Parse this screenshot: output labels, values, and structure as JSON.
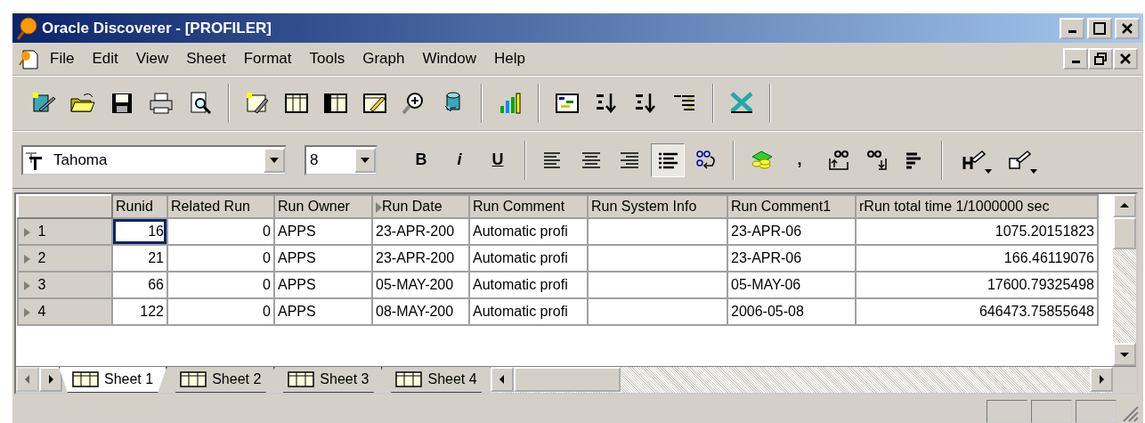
{
  "window": {
    "title": "Oracle Discoverer - [PROFILER]"
  },
  "menu": [
    "File",
    "Edit",
    "View",
    "Sheet",
    "Format",
    "Tools",
    "Graph",
    "Window",
    "Help"
  ],
  "format_bar": {
    "font": "Tahoma",
    "size": "8",
    "buttons": [
      {
        "kind": "bold",
        "label": "B",
        "pressed": false
      },
      {
        "kind": "italic",
        "label": "i",
        "pressed": false
      },
      {
        "kind": "underline",
        "label": "U",
        "pressed": false
      },
      {
        "kind": "separator"
      },
      {
        "kind": "align-left",
        "pressed": false
      },
      {
        "kind": "align-center",
        "pressed": false
      },
      {
        "kind": "align-right",
        "pressed": false
      },
      {
        "kind": "align-auto",
        "pressed": true
      },
      {
        "kind": "wrap",
        "pressed": false
      },
      {
        "kind": "separator"
      },
      {
        "kind": "currency",
        "pressed": false
      },
      {
        "kind": "comma",
        "label": ",",
        "pressed": false
      },
      {
        "kind": "decimal-add",
        "pressed": false
      },
      {
        "kind": "decimal-remove",
        "pressed": false
      },
      {
        "kind": "bar",
        "pressed": false
      },
      {
        "kind": "separator"
      },
      {
        "kind": "painter",
        "pressed": false
      },
      {
        "kind": "border",
        "pressed": false
      }
    ]
  },
  "grid": {
    "columns": [
      {
        "label": "Runid",
        "numeric": true,
        "marked": false
      },
      {
        "label": "Related Run",
        "numeric": true,
        "marked": false
      },
      {
        "label": "Run Owner",
        "numeric": false,
        "marked": false
      },
      {
        "label": "Run Date",
        "numeric": false,
        "marked": true
      },
      {
        "label": "Run Comment",
        "numeric": false,
        "marked": false
      },
      {
        "label": "Run System Info",
        "marked": false
      },
      {
        "label": "Run Comment1",
        "numeric": false,
        "marked": false
      },
      {
        "label": "rRun total time 1/1000000 sec",
        "numeric": true,
        "marked": false
      }
    ],
    "rows": [
      {
        "header": "1",
        "cells": [
          {
            "text": "16",
            "selected": true
          },
          {
            "text": "0",
            "selected": false
          },
          {
            "text": "APPS",
            "selected": false
          },
          {
            "text": "23-APR-200",
            "selected": false
          },
          {
            "text": "Automatic profi",
            "selected": false
          },
          {
            "selected": false
          },
          {
            "text": "23-APR-06",
            "selected": false
          },
          {
            "text": "1075.20151823",
            "selected": false
          }
        ]
      },
      {
        "header": "2",
        "cells": [
          {
            "text": "21",
            "selected": false
          },
          {
            "text": "0",
            "selected": false
          },
          {
            "text": "APPS",
            "selected": false
          },
          {
            "text": "23-APR-200",
            "selected": false
          },
          {
            "text": "Automatic profi",
            "selected": false
          },
          {
            "selected": false
          },
          {
            "text": "23-APR-06",
            "selected": false
          },
          {
            "text": "166.46119076",
            "selected": false
          }
        ]
      },
      {
        "header": "3",
        "cells": [
          {
            "text": "66",
            "selected": false
          },
          {
            "text": "0",
            "selected": false
          },
          {
            "text": "APPS",
            "selected": false
          },
          {
            "text": "05-MAY-200",
            "selected": false
          },
          {
            "text": "Automatic profi",
            "selected": false
          },
          {
            "selected": false
          },
          {
            "text": "05-MAY-06",
            "selected": false
          },
          {
            "text": "17600.79325498",
            "selected": false
          }
        ]
      },
      {
        "header": "4",
        "cells": [
          {
            "text": "122",
            "selected": false
          },
          {
            "text": "0",
            "selected": false
          },
          {
            "text": "APPS",
            "selected": false
          },
          {
            "text": "08-MAY-200",
            "selected": false
          },
          {
            "text": "Automatic profi",
            "selected": false
          },
          {
            "selected": false
          },
          {
            "text": "2006-05-08",
            "selected": false
          },
          {
            "text": "646473.75855648",
            "selected": false
          }
        ]
      }
    ]
  },
  "sheets": [
    {
      "label": "Sheet 1",
      "selected": true
    },
    {
      "label": "Sheet 2",
      "selected": false
    },
    {
      "label": "Sheet 3",
      "selected": false
    },
    {
      "label": "Sheet 4",
      "selected": false
    }
  ]
}
